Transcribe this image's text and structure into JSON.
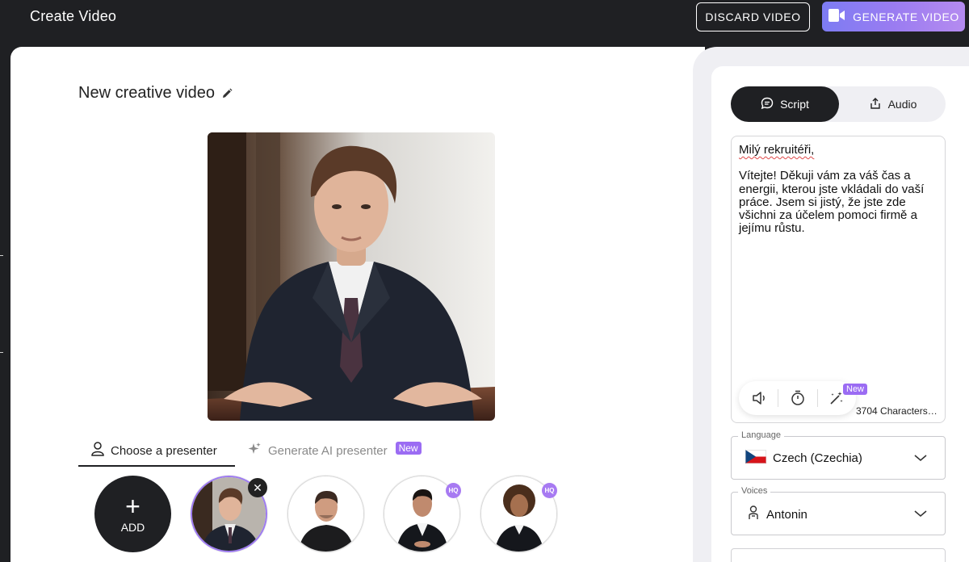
{
  "header": {
    "title": "Create Video",
    "discard_label": "DISCARD VIDEO",
    "generate_label": "GENERATE VIDEO"
  },
  "editor": {
    "video_title": "New creative video"
  },
  "presenter_tabs": {
    "choose_label": "Choose a presenter",
    "generate_label": "Generate AI presenter",
    "new_badge": "New"
  },
  "presenters": {
    "add_label": "ADD",
    "hq_badge": "HQ",
    "remove_glyph": "✕"
  },
  "script_panel": {
    "script_tab": "Script",
    "audio_tab": "Audio",
    "greeting": "Milý rekruitéři,",
    "body": "Vítejte! Děkuji vám za váš čas a energii, kterou jste vkládali do vaší práce. Jsem si jistý, že jste zde všichni za účelem pomoci firmě a jejímu růstu.",
    "new_badge": "New",
    "char_count": "3704 Characters"
  },
  "language": {
    "label": "Language",
    "value": "Czech (Czechia)"
  },
  "voices": {
    "label": "Voices",
    "value": "Antonin"
  },
  "colors": {
    "dark": "#1f2023",
    "accent_purple": "#9b6cf3",
    "panel_bg": "#efeff3"
  },
  "icons": [
    "video-camera-icon",
    "pencil-icon",
    "person-icon",
    "sparkle-icon",
    "plus-icon",
    "close-icon",
    "chat-icon",
    "upload-icon",
    "speaker-icon",
    "timer-icon",
    "magic-wand-icon",
    "flag-cz-icon",
    "chevron-down-icon",
    "voice-person-icon"
  ]
}
